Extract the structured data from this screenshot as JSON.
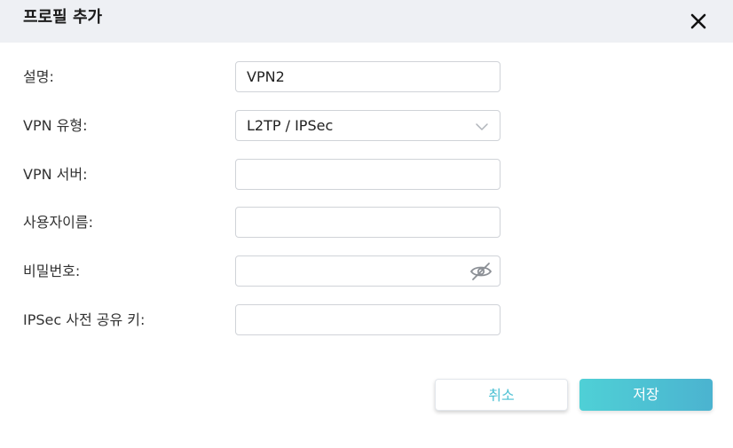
{
  "dialog": {
    "title": "프로필 추가",
    "close_icon": "close-icon"
  },
  "form": {
    "description": {
      "label": "설명:",
      "value": "VPN2"
    },
    "vpn_type": {
      "label": "VPN 유형:",
      "value": "L2TP / IPSec",
      "icon": "chevron-down-icon"
    },
    "vpn_server": {
      "label": "VPN 서버:",
      "value": ""
    },
    "username": {
      "label": "사용자이름:",
      "value": ""
    },
    "password": {
      "label": "비밀번호:",
      "value": "",
      "icon": "eye-off-icon"
    },
    "psk": {
      "label": "IPSec 사전 공유 키:",
      "value": ""
    }
  },
  "buttons": {
    "cancel": "취소",
    "save": "저장"
  },
  "colors": {
    "accent": "#4cc0d3",
    "header_bg": "#eef0f4"
  }
}
